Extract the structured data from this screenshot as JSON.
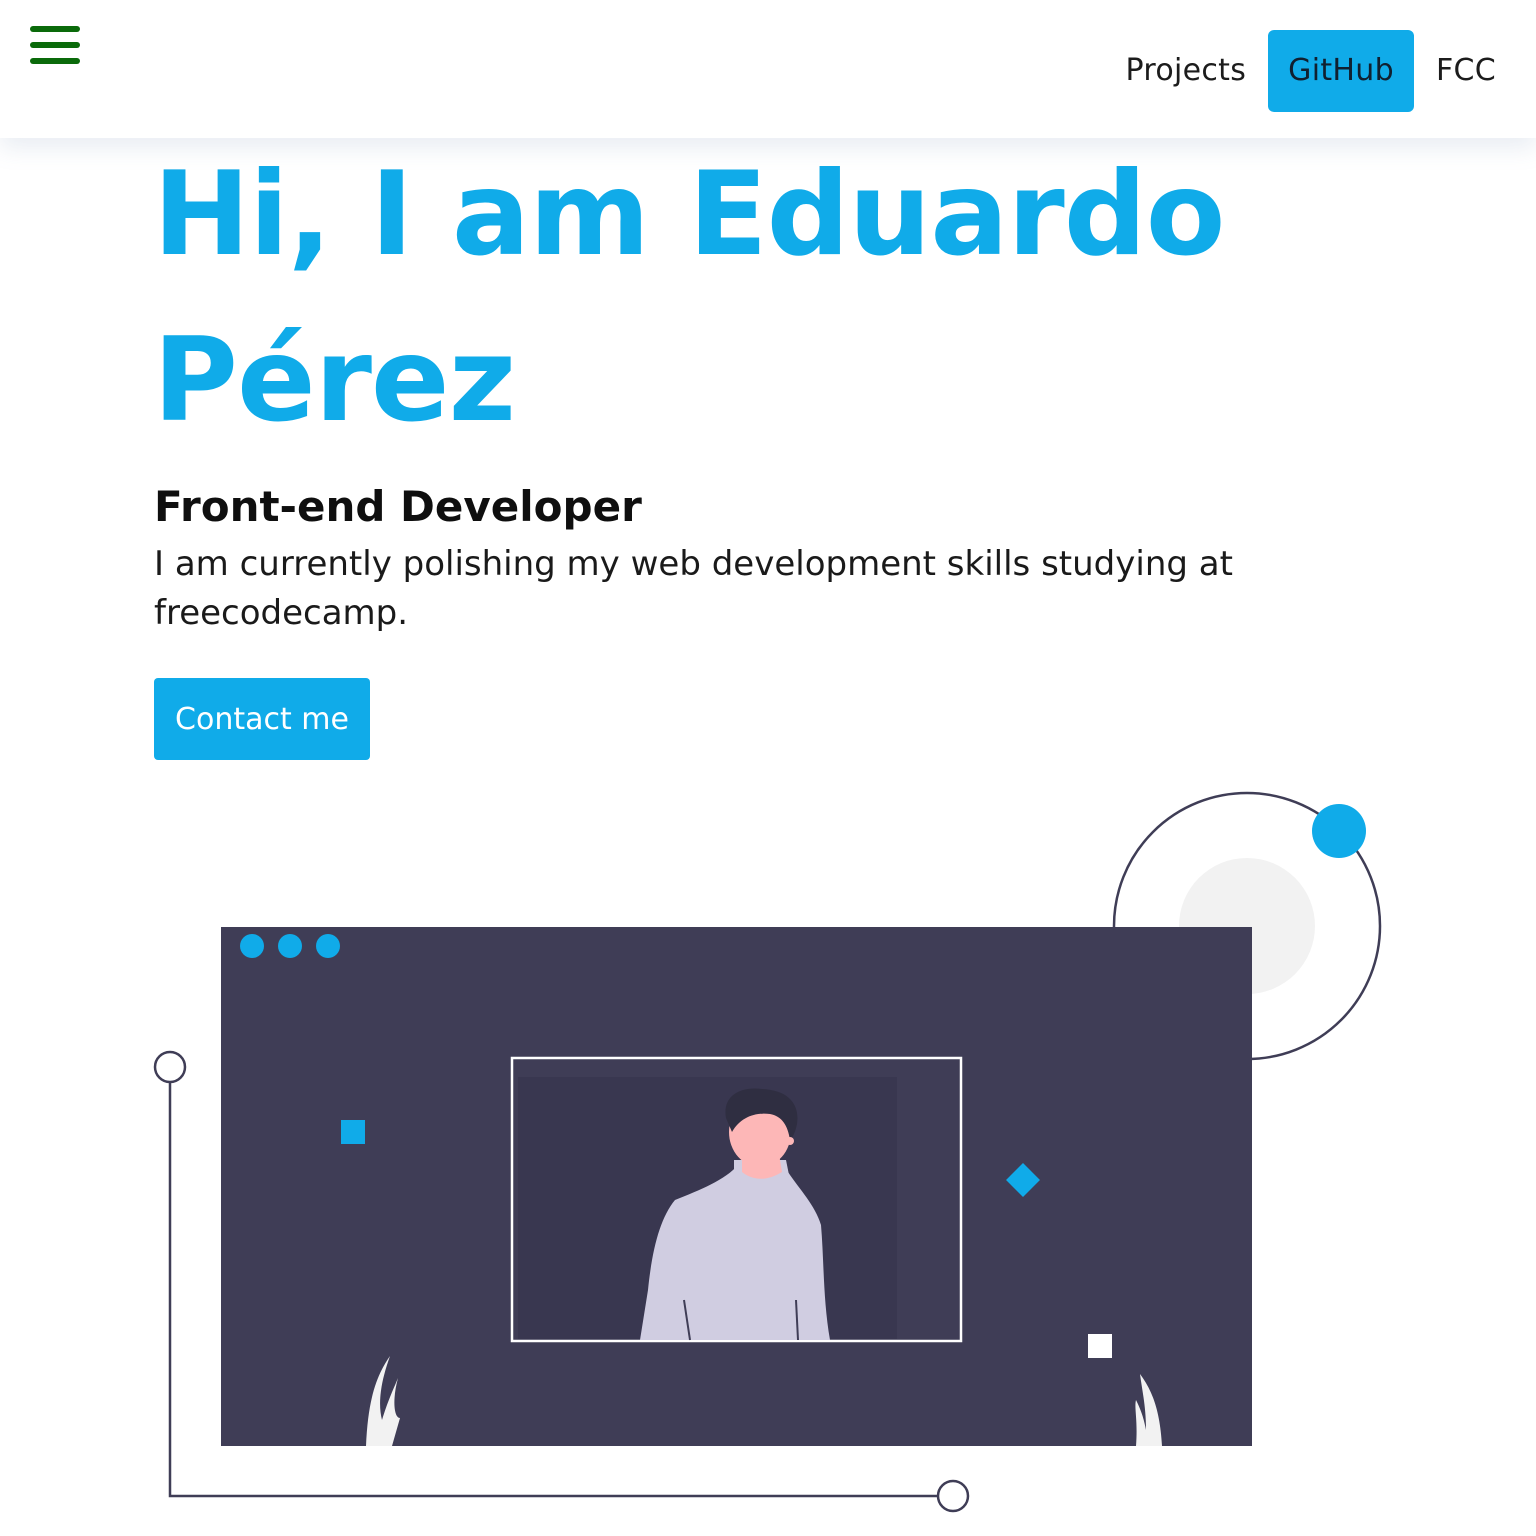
{
  "nav": {
    "menu_icon": "hamburger-menu-icon",
    "links": [
      {
        "label": "Projects",
        "active": false
      },
      {
        "label": "GitHub",
        "active": true
      },
      {
        "label": "FCC",
        "active": false
      }
    ]
  },
  "hero": {
    "title_line1": "Hi, I am Eduardo",
    "title_line2": "Pérez",
    "subtitle": "Front-end Developer",
    "description": "I am currently polishing my web development skills studying at freecodecamp.",
    "contact_label": "Contact me"
  },
  "illustration": {
    "name": "developer-portrait-illustration",
    "colors": {
      "accent": "#10abe9",
      "window": "#3f3d56",
      "photo_bg": "#3a384f",
      "person_shirt": "#d0cde1",
      "person_skin": "#fdb7b7",
      "person_hair": "#2f2e41",
      "light_gray": "#f2f2f2"
    }
  },
  "theme": {
    "primary": "#10abe9",
    "menu_icon_color": "#0a6a0a",
    "text_dark": "#1a1a1a"
  }
}
